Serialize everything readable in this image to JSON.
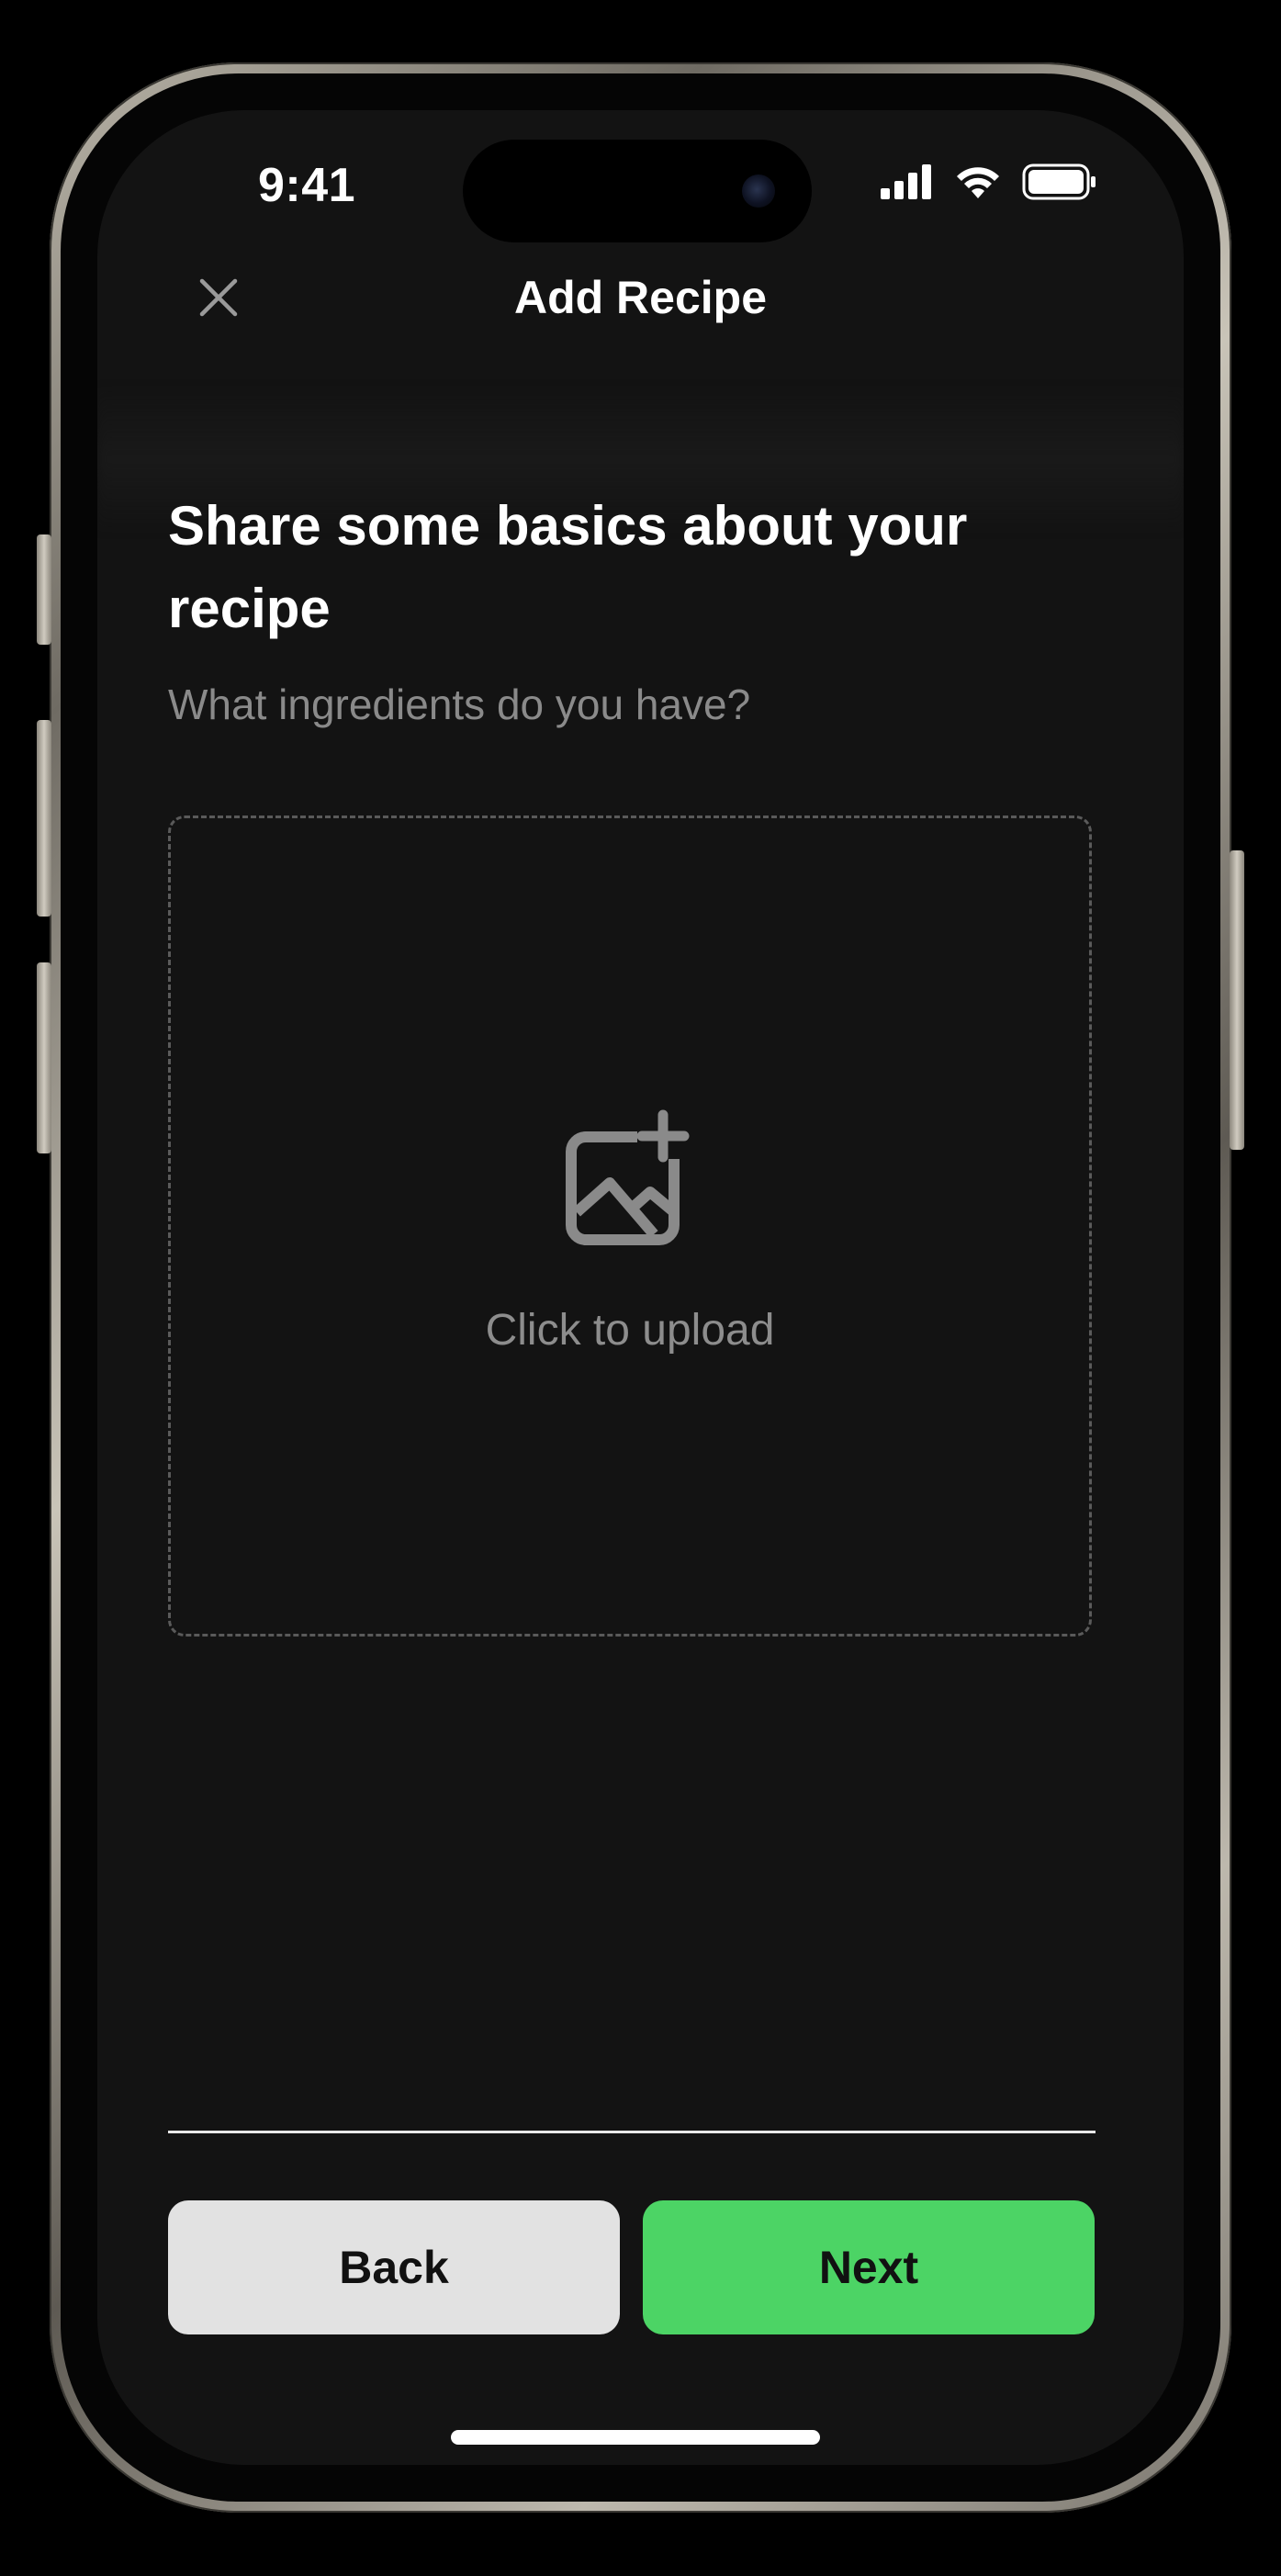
{
  "status_bar": {
    "time": "9:41",
    "icons": [
      "cellular-signal-icon",
      "wifi-icon",
      "battery-icon"
    ]
  },
  "nav": {
    "title": "Add Recipe",
    "close_icon": "close-icon"
  },
  "content": {
    "heading": "Share some basics about your recipe",
    "subheading": "What ingredients do you have?",
    "upload": {
      "icon": "add-image-icon",
      "label": "Click to upload"
    }
  },
  "footer": {
    "back_label": "Back",
    "next_label": "Next"
  },
  "colors": {
    "background": "#131313",
    "accent": "#4cd465",
    "secondary_button": "#e2e2e2",
    "muted_text": "#8a8a8a"
  }
}
